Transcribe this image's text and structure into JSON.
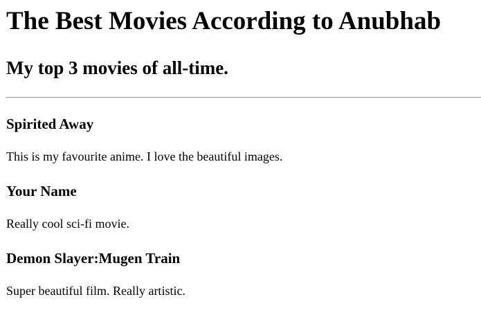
{
  "header": {
    "title": "The Best Movies According to Anubhab",
    "subtitle": "My top 3 movies of all-time."
  },
  "movies": [
    {
      "title": "Spirited Away",
      "description": "This is my favourite anime. I love the beautiful images."
    },
    {
      "title": "Your Name",
      "description": "Really cool sci-fi movie."
    },
    {
      "title": "Demon Slayer:Mugen Train",
      "description": "Super beautiful film. Really artistic."
    }
  ]
}
